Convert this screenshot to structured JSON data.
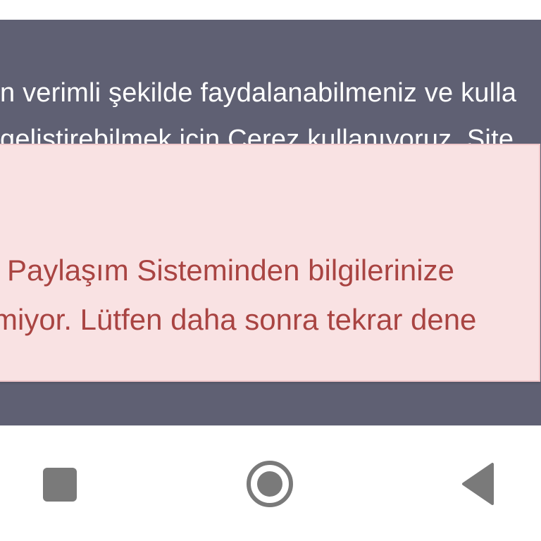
{
  "cookie_notice": {
    "line1": "n verimli şekilde faydalanabilmeniz ve kulla",
    "line2": "gelistirebilmek icin Cerez kullanıyoruz. Site"
  },
  "error_alert": {
    "line1": "Paylaşım Sisteminden bilgilerinize",
    "line2": "miyor. Lütfen daha sonra tekrar dene"
  },
  "colors": {
    "cookie_background": "#5f6073",
    "alert_background": "#f9e2e3",
    "alert_text": "#a94442",
    "nav_icon": "#7a7a7a"
  },
  "navigation": {
    "recents_icon": "square-icon",
    "home_icon": "circle-home-icon",
    "back_icon": "triangle-back-icon"
  }
}
